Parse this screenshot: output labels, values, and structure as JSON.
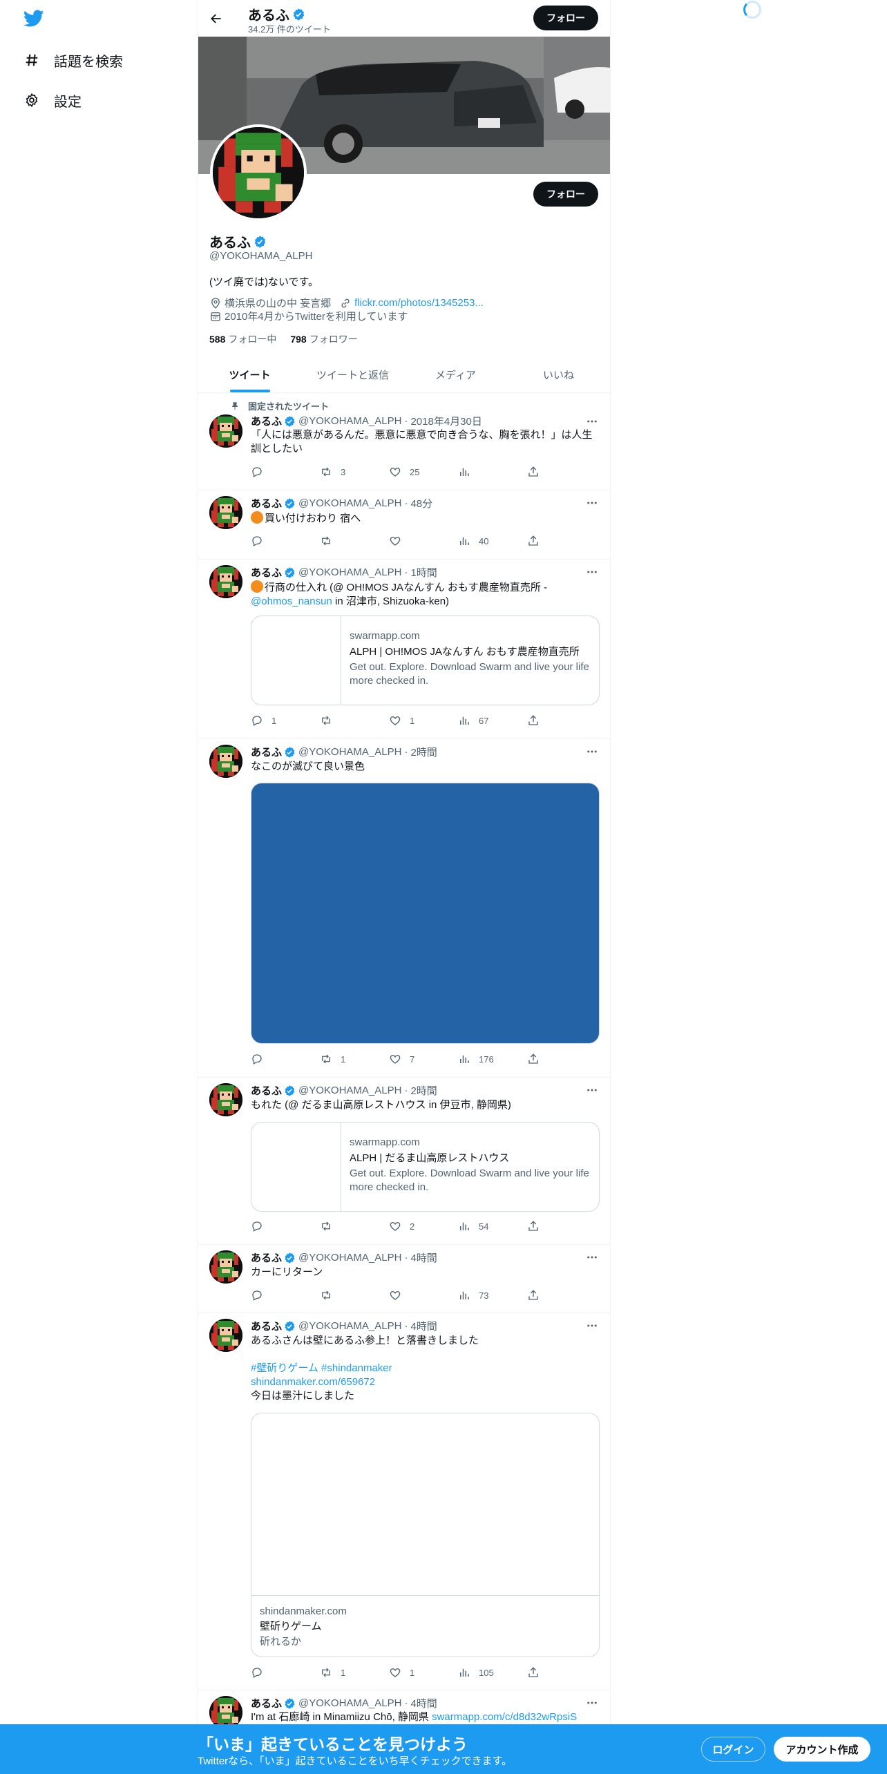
{
  "nav": {
    "explore_label": "話題を検索",
    "settings_label": "設定"
  },
  "header": {
    "name": "あるふ",
    "tweet_count": "34.2万 件のツイート",
    "follow_label": "フォロー"
  },
  "profile": {
    "follow_label": "フォロー",
    "name": "あるふ",
    "handle": "@YOKOHAMA_ALPH",
    "bio": "(ツイ廃では)ないです。",
    "location": "横浜県の山の中 妄言郷",
    "url": "flickr.com/photos/1345253...",
    "joined": "2010年4月からTwitterを利用しています",
    "following_count": "588",
    "following_label": "フォロー中",
    "followers_count": "798",
    "followers_label": "フォロワー"
  },
  "tabs": [
    {
      "label": "ツイート"
    },
    {
      "label": "ツイートと返信"
    },
    {
      "label": "メディア"
    },
    {
      "label": "いいね"
    }
  ],
  "tweets": [
    {
      "pinned_label": "固定されたツイート",
      "name": "あるふ",
      "handle": "@YOKOHAMA_ALPH",
      "time": "2018年4月30日",
      "text": "「人には悪意があるんだ。悪意に悪意で向き合うな、胸を張れ！」は人生訓としたい",
      "replies": "",
      "retweets": "3",
      "likes": "25",
      "views": ""
    },
    {
      "name": "あるふ",
      "handle": "@YOKOHAMA_ALPH",
      "time": "48分",
      "text": "買い付けおわり 宿へ",
      "replies": "",
      "retweets": "",
      "likes": "",
      "views": "40"
    },
    {
      "name": "あるふ",
      "handle": "@YOKOHAMA_ALPH",
      "time": "1時間",
      "text_a": "行商の仕入れ (@ OH!MOS JAなんすん おもす農産物直売所 - ",
      "text_link": "@ohmos_nansun",
      "text_b": " in 沼津市, Shizuoka-ken)",
      "card": {
        "domain": "swarmapp.com",
        "title": "ALPH | OH!MOS JAなんすん おもす農産物直売所",
        "desc": "Get out. Explore. Download Swarm and live your life more checked in."
      },
      "replies": "1",
      "retweets": "",
      "likes": "1",
      "views": "67"
    },
    {
      "name": "あるふ",
      "handle": "@YOKOHAMA_ALPH",
      "time": "2時間",
      "text": "なこのが滅びて良い景色",
      "replies": "",
      "retweets": "1",
      "likes": "7",
      "views": "176"
    },
    {
      "name": "あるふ",
      "handle": "@YOKOHAMA_ALPH",
      "time": "2時間",
      "text": "もれた (@ だるま山高原レストハウス in 伊豆市, 静岡県)",
      "card": {
        "domain": "swarmapp.com",
        "title": "ALPH | だるま山高原レストハウス",
        "desc": "Get out. Explore. Download Swarm and live your life more checked in."
      },
      "replies": "",
      "retweets": "",
      "likes": "2",
      "views": "54"
    },
    {
      "name": "あるふ",
      "handle": "@YOKOHAMA_ALPH",
      "time": "4時間",
      "text": "カーにリターン",
      "replies": "",
      "retweets": "",
      "likes": "",
      "views": "73"
    },
    {
      "name": "あるふ",
      "handle": "@YOKOHAMA_ALPH",
      "time": "4時間",
      "line1": "あるふさんは壁にあるふ参上！と落書きしました",
      "hashtags": "#壁斫りゲーム #shindanmaker",
      "link": "shindanmaker.com/659672",
      "line2": "今日は墨汁にしました",
      "card": {
        "domain": "shindanmaker.com",
        "title": "壁斫りゲーム",
        "desc": "斫れるか"
      },
      "replies": "",
      "retweets": "1",
      "likes": "1",
      "views": "105"
    },
    {
      "name": "あるふ",
      "handle": "@YOKOHAMA_ALPH",
      "time": "4時間",
      "text_a": "I'm at 石廊崎 in Minamiizu Chō, 静岡県 ",
      "text_link": "swarmapp.com/c/d8d32wRpsiS"
    }
  ],
  "bottom_bar": {
    "title": "「いま」起きていることを見つけよう",
    "subtitle": "Twitterなら、「いま」起きていることをいち早くチェックできます。",
    "login_label": "ログイン",
    "signup_label": "アカウント作成"
  },
  "colors": {
    "accent": "#1d9bf0",
    "text": "#0f1419",
    "muted": "#536471",
    "media_placeholder": "#2563a7"
  }
}
